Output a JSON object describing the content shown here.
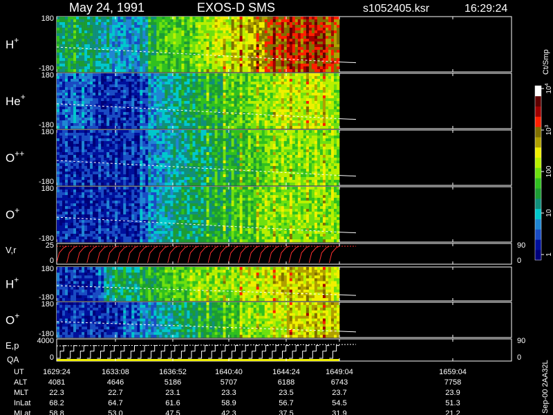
{
  "header": {
    "date": "May 24, 1991",
    "instrument": "EXOS-D SMS",
    "file": "s1052405.ksr",
    "time": "16:29:24"
  },
  "colorbar": {
    "unit": "Ct/Smp",
    "ticks": [
      {
        "label": "1",
        "value": 1
      },
      {
        "label": "10",
        "value": 10
      },
      {
        "label": "100",
        "value": 100
      },
      {
        "label": "10",
        "sup": "3",
        "value": 1000
      },
      {
        "label": "10",
        "sup": "4",
        "value": 10000
      }
    ],
    "colors": [
      "#00007a",
      "#00109c",
      "#1a4cc4",
      "#1f86d4",
      "#00c8cc",
      "#108f7c",
      "#1c9c34",
      "#30c020",
      "#6ee010",
      "#b8f000",
      "#f0f000",
      "#b0a000",
      "#807000",
      "#ff2000",
      "#a00000",
      "#600000",
      "#ffffff"
    ]
  },
  "chart_data": [
    {
      "type": "heatmap",
      "name": "H+",
      "ion": "H",
      "charge": "+",
      "ylim": [
        -180,
        180
      ],
      "y_ticks": [
        "180",
        "-180"
      ],
      "intensity_profile": [
        5,
        6,
        5,
        5,
        4,
        4,
        3,
        3,
        3,
        4,
        6,
        7,
        7,
        7,
        7,
        8,
        8,
        9,
        9,
        10,
        10,
        11,
        11,
        12,
        12,
        13,
        12,
        13,
        13,
        12,
        12
      ]
    },
    {
      "type": "heatmap",
      "name": "He+",
      "ion": "He",
      "charge": "+",
      "ylim": [
        -180,
        180
      ],
      "y_ticks": [
        "180",
        "-180"
      ],
      "intensity_profile": [
        2,
        2,
        2,
        2,
        1,
        1,
        1,
        1,
        1,
        2,
        3,
        4,
        4,
        5,
        5,
        6,
        6,
        6,
        7,
        7,
        7,
        8,
        8,
        8,
        9,
        9,
        9,
        9,
        9,
        9,
        8
      ]
    },
    {
      "type": "heatmap",
      "name": "O++",
      "ion": "O",
      "charge": "++",
      "ylim": [
        -180,
        180
      ],
      "y_ticks": [
        "180",
        "-180"
      ],
      "intensity_profile": [
        1,
        1,
        1,
        1,
        1,
        1,
        1,
        1,
        1,
        2,
        3,
        3,
        4,
        4,
        5,
        5,
        5,
        6,
        6,
        6,
        7,
        7,
        7,
        8,
        8,
        8,
        8,
        8,
        8,
        8,
        8
      ]
    },
    {
      "type": "heatmap",
      "name": "O+",
      "ion": "O",
      "charge": "+",
      "ylim": [
        -180,
        180
      ],
      "y_ticks": [
        "180",
        "-180"
      ],
      "intensity_profile": [
        1,
        1,
        1,
        1,
        1,
        1,
        1,
        1,
        1,
        2,
        3,
        4,
        4,
        5,
        5,
        5,
        6,
        6,
        6,
        7,
        7,
        7,
        8,
        8,
        8,
        8,
        8,
        8,
        8,
        8,
        8
      ]
    },
    {
      "type": "line",
      "name": "V,r",
      "ylim": [
        0,
        25
      ],
      "y_ticks": [
        "25",
        "0"
      ],
      "right_ticks": [
        "90",
        "0"
      ],
      "color": "#ff3030"
    },
    {
      "type": "heatmap",
      "name": "H+",
      "ion": "H",
      "charge": "+",
      "ylim": [
        -180,
        180
      ],
      "y_ticks": [
        "180",
        "-180"
      ],
      "intensity_profile": [
        1,
        1,
        1,
        1,
        2,
        4,
        5,
        5,
        5,
        6,
        6,
        7,
        7,
        7,
        8,
        8,
        8,
        8,
        8,
        8,
        9,
        9,
        9,
        9,
        10,
        10,
        10,
        10,
        10,
        10,
        9
      ]
    },
    {
      "type": "heatmap",
      "name": "O+",
      "ion": "O",
      "charge": "+",
      "ylim": [
        -180,
        180
      ],
      "y_ticks": [
        "180",
        "-180"
      ],
      "intensity_profile": [
        1,
        1,
        1,
        1,
        1,
        1,
        1,
        2,
        2,
        3,
        3,
        4,
        4,
        5,
        5,
        6,
        6,
        6,
        7,
        7,
        8,
        8,
        8,
        9,
        9,
        10,
        10,
        10,
        10,
        10,
        10
      ]
    },
    {
      "type": "line",
      "name": "E,p",
      "ylim": [
        0,
        4000
      ],
      "y_ticks": [
        "4000",
        "0"
      ],
      "right_ticks": [
        "90",
        "0"
      ],
      "color": "#ffffff"
    }
  ],
  "qa_label": "QA",
  "table": {
    "rows": [
      {
        "label": "UT",
        "values": [
          "1629:24",
          "1633:08",
          "1636:52",
          "1640:40",
          "1644:24",
          "1649:04",
          "1659:04"
        ]
      },
      {
        "label": "ALT",
        "values": [
          "4081",
          "4646",
          "5186",
          "5707",
          "6188",
          "6743",
          "7758"
        ]
      },
      {
        "label": "MLT",
        "values": [
          "22.3",
          "22.7",
          "23.1",
          "23.3",
          "23.5",
          "23.7",
          "23.9"
        ]
      },
      {
        "label": "InLat",
        "values": [
          "68.2",
          "64.7",
          "61.6",
          "58.9",
          "56.7",
          "54.5",
          "51.3"
        ]
      },
      {
        "label": "MLat",
        "values": [
          "58.8",
          "53.0",
          "47.5",
          "42.3",
          "37.5",
          "31.9",
          "21.2"
        ]
      }
    ]
  },
  "footer_tag": "Sep-00 2AA32L"
}
